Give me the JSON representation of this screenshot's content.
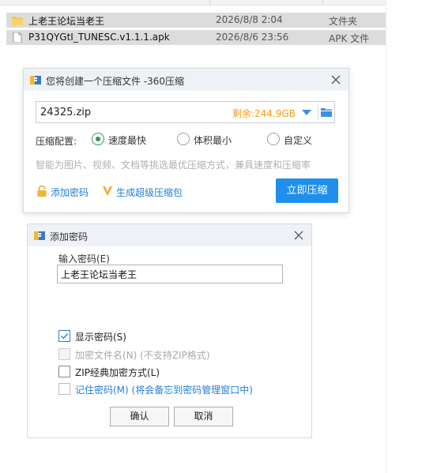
{
  "colors": {
    "accent": "#1e8fec",
    "remain": "#f39c12",
    "radio_selected": "#2a9a4f",
    "link": "#1f7ed8",
    "row_selected": "#dcdcdc"
  },
  "filelist": {
    "rows": [
      {
        "icon": "folder-icon",
        "name": "上老王论坛当老王",
        "date": "2026/8/8 2:04",
        "type": "文件夹"
      },
      {
        "icon": "file-icon",
        "name": "P31QYGtI_TUNESC.v1.1.1.apk",
        "date": "2026/8/6 23:56",
        "type": "APK 文件"
      }
    ]
  },
  "compress_dialog": {
    "title": "您将创建一个压缩文件 -360压缩",
    "filename": "24325.zip",
    "remaining": "剩余:244.9GB",
    "config_label": "压缩配置:",
    "options": [
      {
        "label": "速度最快",
        "selected": true
      },
      {
        "label": "体积最小",
        "selected": false
      },
      {
        "label": "自定义",
        "selected": false
      }
    ],
    "hint": "智能为图片、视频、文档等挑选最优压缩方式，兼具速度和压缩率",
    "add_password": "添加密码",
    "super_package": "生成超级压缩包",
    "compress_button": "立即压缩"
  },
  "password_dialog": {
    "title": "添加密码",
    "input_label": "输入密码(E)",
    "password_value": "上老王论坛当老王",
    "checkboxes": [
      {
        "label": "显示密码(S)",
        "checked": true,
        "disabled": false
      },
      {
        "label": "加密文件名(N) (不支持ZIP格式)",
        "checked": false,
        "disabled": true
      },
      {
        "label": "ZIP经典加密方式(L)",
        "checked": false,
        "disabled": false
      },
      {
        "label": "记住密码(M) (将会备忘到密码管理窗口中)",
        "checked": false,
        "disabled": false
      }
    ],
    "ok_button": "确认",
    "cancel_button": "取消"
  }
}
